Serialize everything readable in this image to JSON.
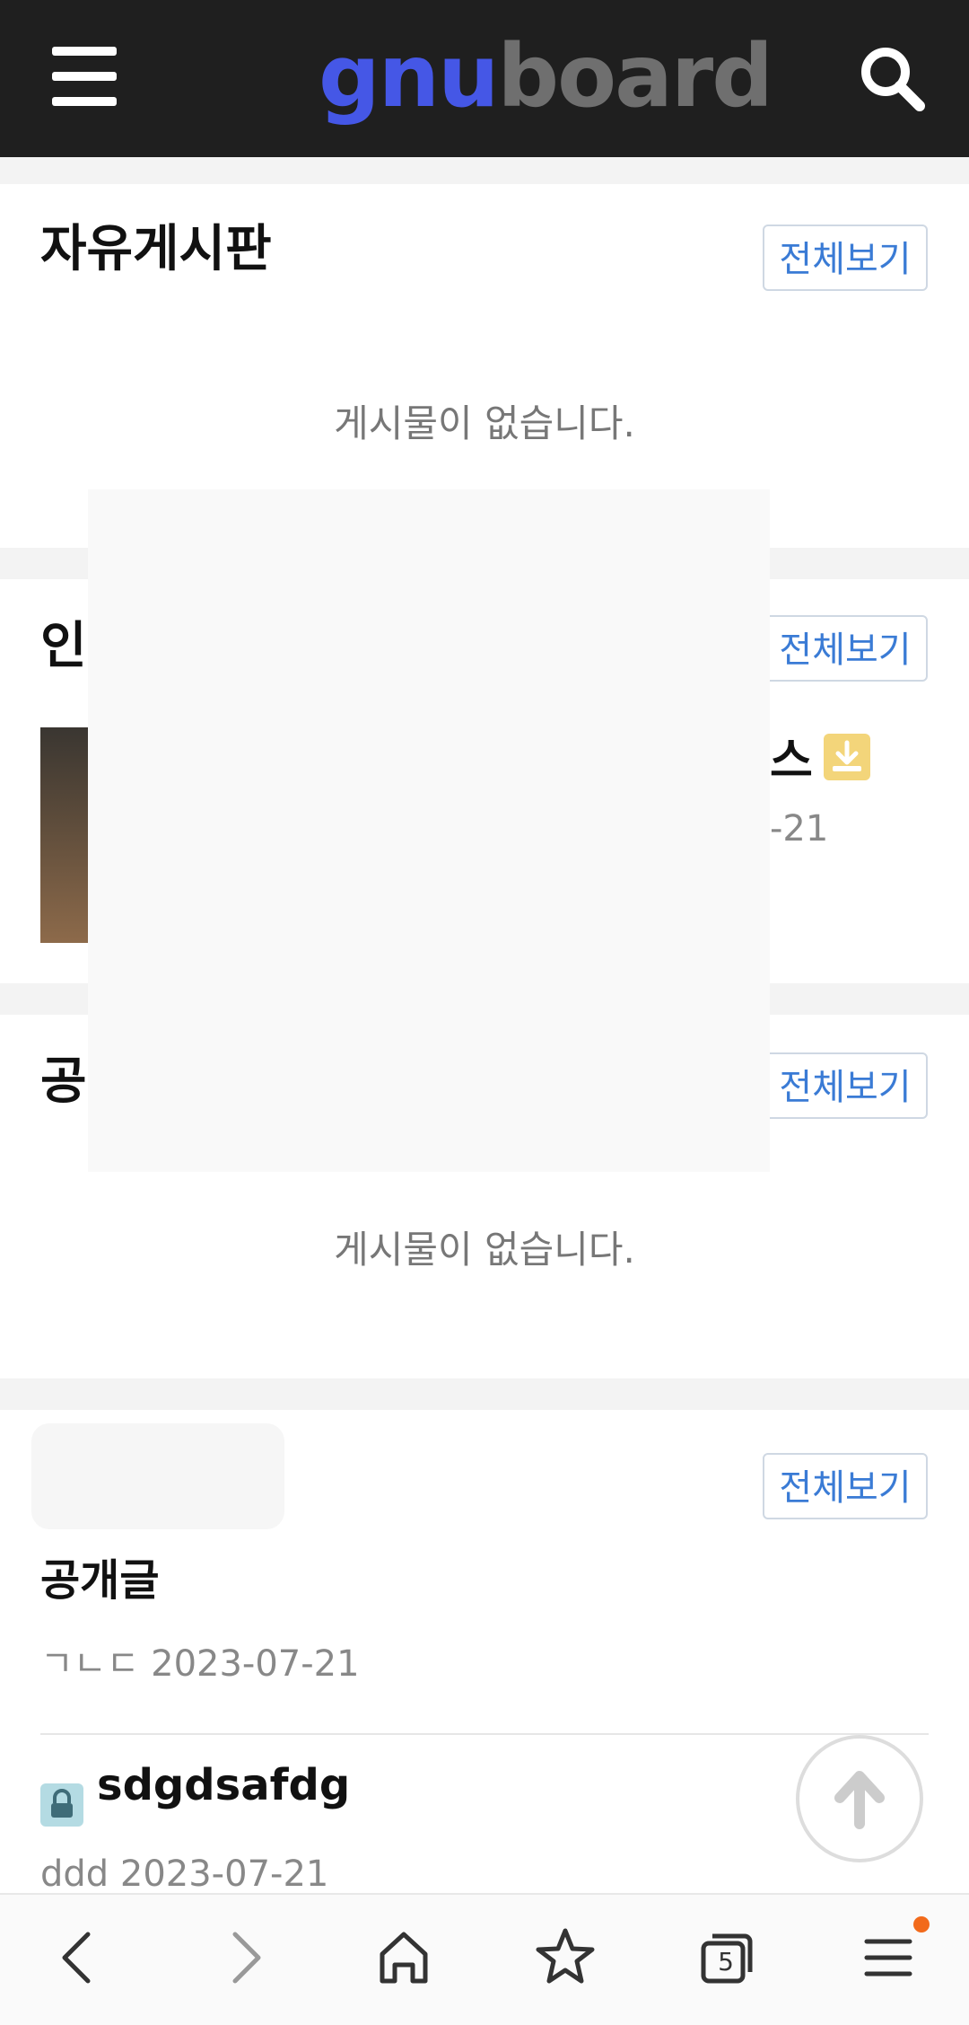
{
  "header": {
    "logo_part1": "gnu",
    "logo_part2": "board"
  },
  "sections": [
    {
      "title": "자유게시판",
      "more_label": "전체보기",
      "empty_text": "게시물이 없습니다."
    },
    {
      "title": "인",
      "more_label": "전체보기",
      "partial_post_title": "스",
      "partial_post_date": "-21"
    },
    {
      "title": "공",
      "more_label": "전체보기",
      "empty_text": "게시물이 없습니다."
    },
    {
      "more_label": "전체보기",
      "posts": [
        {
          "title": "공개글",
          "meta": "ㄱㄴㄷ 2023-07-21"
        },
        {
          "title": "sdgdsafdg",
          "meta": "ddd 2023-07-21"
        }
      ]
    }
  ],
  "bottom_nav": {
    "tab_count": "5"
  },
  "colors": {
    "accent": "#3a7bd5",
    "logo_blue": "#4557e6",
    "badge": "#f26a1b"
  }
}
